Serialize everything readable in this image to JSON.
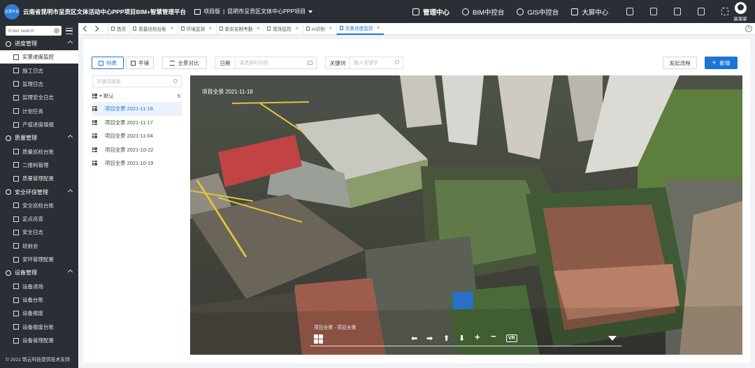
{
  "header": {
    "system_title": "云南省昆明市呈贡区文体活动中心PPP项目BIM+智慧管理平台",
    "project_mode": "项目版",
    "project_name": "昆明市呈贡区文体中心PPP项目",
    "logo_text": "云慧平台",
    "modules": [
      {
        "label": "管理中心",
        "icon": "management-icon",
        "active": true
      },
      {
        "label": "BIM中控台",
        "icon": "bim-icon",
        "active": false
      },
      {
        "label": "GIS中控台",
        "icon": "globe-icon",
        "active": false
      },
      {
        "label": "大屏中心",
        "icon": "screen-icon",
        "active": false
      }
    ],
    "tools": [
      "chat-icon",
      "document-icon",
      "tablet-icon",
      "download-icon",
      "fullscreen-icon"
    ],
    "user": "高保家"
  },
  "sidebar": {
    "search_placeholder": "Enter search",
    "groups": [
      {
        "label": "进度管理",
        "items": [
          "实景进度监控",
          "施工日志",
          "监理日志",
          "监理安全日志",
          "计划任务",
          "产值进度填报"
        ]
      },
      {
        "label": "质量管理",
        "items": [
          "质量巡检台账",
          "二维码管理",
          "质量管理配置"
        ]
      },
      {
        "label": "安全环保管理",
        "items": [
          "安全巡检台账",
          "定点巡查",
          "安全日志",
          "班前会",
          "安环管理配置"
        ]
      },
      {
        "label": "设备管理",
        "items": [
          "设备退场",
          "设备台账",
          "设备报废",
          "设备报废台账",
          "设备管理配置"
        ]
      }
    ],
    "active_item": "实景进度监控",
    "footer": "© 2021 筑云科技提供技术支持"
  },
  "tabs": [
    {
      "label": "首页",
      "closable": false,
      "active": false
    },
    {
      "label": "质量巡检台账",
      "closable": true,
      "active": false
    },
    {
      "label": "环境监测",
      "closable": true,
      "active": false
    },
    {
      "label": "新实名制考勤",
      "closable": true,
      "active": false
    },
    {
      "label": "现场监控",
      "closable": true,
      "active": false
    },
    {
      "label": "AI识别",
      "closable": true,
      "active": false
    },
    {
      "label": "实景进度监控",
      "closable": true,
      "active": true
    }
  ],
  "toolbar": {
    "list_label": "列表",
    "tile_label": "平铺",
    "compare_label": "全景对比",
    "date_label": "日期",
    "date_placeholder": "请选择时间段",
    "keyword_label": "关键词",
    "keyword_placeholder": "输入关键字",
    "process_label": "发起流程",
    "add_label": "新增"
  },
  "tree": {
    "search_placeholder": "关键词搜索",
    "root_label": "默认",
    "root_count": "5",
    "items": [
      "项目全景 2021-11-18",
      "项目全景 2021-11-17",
      "项目全景 2021-11-04",
      "项目全景 2021-10-22",
      "项目全景 2021-10-19"
    ],
    "active_index": 0
  },
  "viewer": {
    "title": "项目全景 2021-11-18",
    "caption": "项目全景 - 项目全景",
    "controls": [
      "left-arrow-icon",
      "right-arrow-icon",
      "up-arrow-icon",
      "down-arrow-icon",
      "zoom-in-icon",
      "zoom-out-icon"
    ],
    "vr_label": "VR"
  },
  "colors": {
    "accent": "#1d74d8",
    "chrome": "#2a2e35"
  }
}
